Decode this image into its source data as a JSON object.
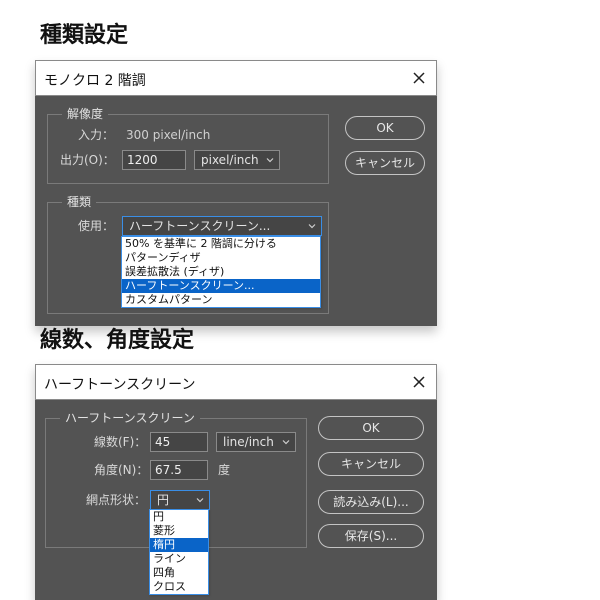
{
  "section1": {
    "heading": "種類設定"
  },
  "dialog1": {
    "title": "モノクロ 2 階調",
    "resolution": {
      "legend": "解像度",
      "input_label": "入力：",
      "input_value": "300 pixel/inch",
      "output_label": "出力(O)：",
      "output_value": "1200",
      "output_unit": "pixel/inch"
    },
    "type": {
      "legend": "種類",
      "use_label": "使用：",
      "selected": "ハーフトーンスクリーン...",
      "options": [
        "50% を基準に 2 階調に分ける",
        "パターンディザ",
        "誤差拡散法 (ディザ)",
        "ハーフトーンスクリーン...",
        "カスタムパターン"
      ],
      "selected_index": 3
    },
    "buttons": {
      "ok": "OK",
      "cancel": "キャンセル"
    }
  },
  "section2": {
    "heading": "線数、角度設定"
  },
  "dialog2": {
    "title": "ハーフトーンスクリーン",
    "group_legend": "ハーフトーンスクリーン",
    "frequency": {
      "label": "線数(F)：",
      "value": "45",
      "unit": "line/inch"
    },
    "angle": {
      "label": "角度(N)：",
      "value": "67.5",
      "unit": "度"
    },
    "shape": {
      "label": "網点形状：",
      "selected": "円",
      "options": [
        "円",
        "菱形",
        "楕円",
        "ライン",
        "四角",
        "クロス"
      ],
      "selected_index": 2
    },
    "buttons": {
      "ok": "OK",
      "cancel": "キャンセル",
      "load": "読み込み(L)...",
      "save": "保存(S)..."
    }
  }
}
